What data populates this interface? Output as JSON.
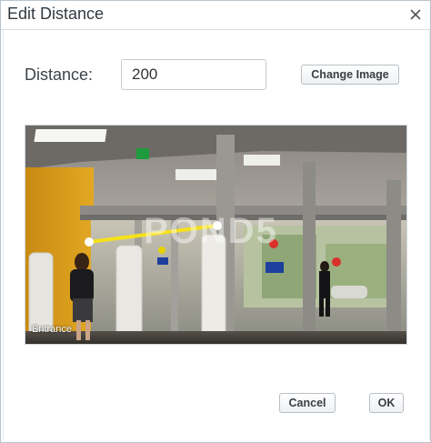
{
  "dialog": {
    "title": "Edit Distance",
    "close_icon": "close-icon"
  },
  "form": {
    "distance_label": "Distance:",
    "distance_value": "200",
    "change_image_label": "Change Image"
  },
  "image": {
    "caption": "Entrance",
    "watermark": "POND5",
    "measure_line_color": "#f5e11c"
  },
  "footer": {
    "cancel_label": "Cancel",
    "ok_label": "OK"
  }
}
